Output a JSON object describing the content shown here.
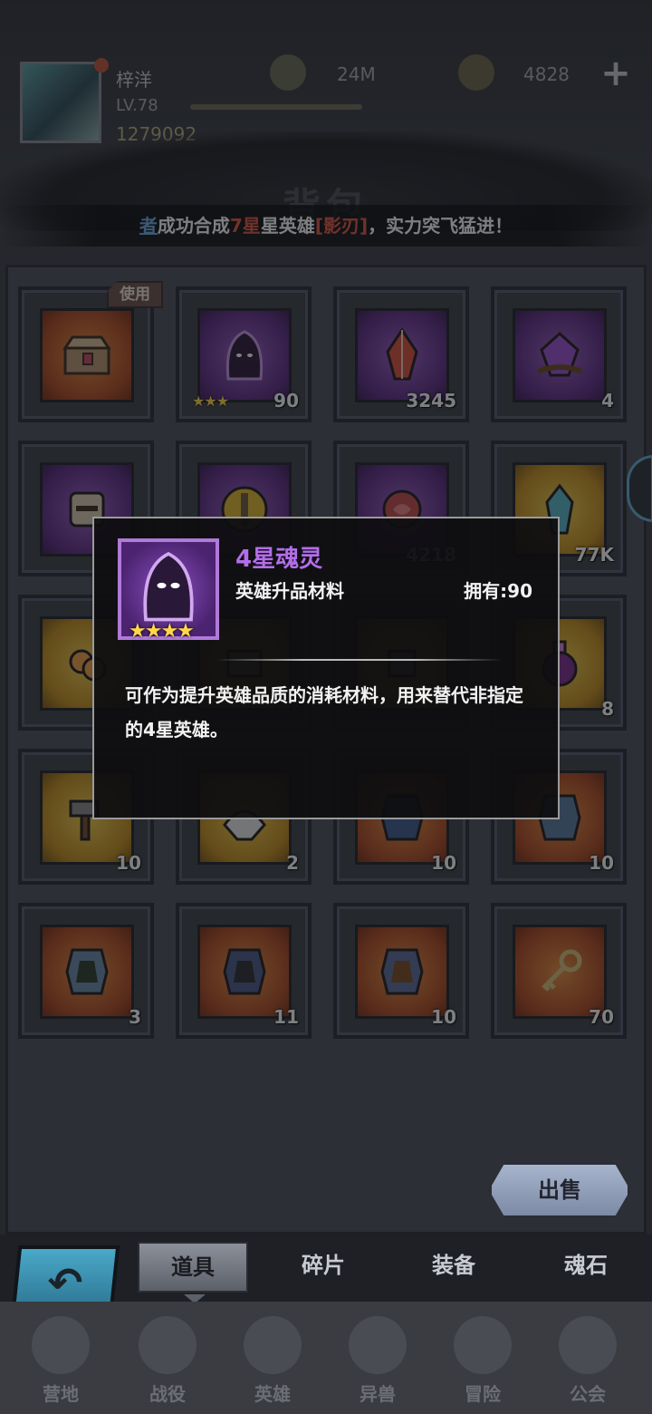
{
  "header": {
    "player_name": "梓洋",
    "level": "LV.78",
    "power": "1279092",
    "resource_1": "24M",
    "resource_2": "4828",
    "plus": "+"
  },
  "title": "背包",
  "ticker": {
    "name": "者",
    "text_1": "成功合成",
    "star": "7星",
    "text_2": "星英雄",
    "hero": "[影刃]",
    "text_3": "，实力突飞猛进！"
  },
  "use_tag": "使用",
  "slots": [
    {
      "count": "",
      "stars": ""
    },
    {
      "count": "90",
      "stars": "★★★"
    },
    {
      "count": "3245",
      "stars": ""
    },
    {
      "count": "4",
      "stars": ""
    },
    {
      "count": "",
      "stars": ""
    },
    {
      "count": "",
      "stars": ""
    },
    {
      "count": "4218",
      "stars": ""
    },
    {
      "count": "77K",
      "stars": ""
    },
    {
      "count": "",
      "stars": ""
    },
    {
      "count": "",
      "stars": ""
    },
    {
      "count": "",
      "stars": ""
    },
    {
      "count": "8",
      "stars": ""
    },
    {
      "count": "10",
      "stars": ""
    },
    {
      "count": "2",
      "stars": ""
    },
    {
      "count": "10",
      "stars": ""
    },
    {
      "count": "10",
      "stars": ""
    },
    {
      "count": "3",
      "stars": ""
    },
    {
      "count": "11",
      "stars": ""
    },
    {
      "count": "10",
      "stars": ""
    },
    {
      "count": "70",
      "stars": ""
    }
  ],
  "tooltip": {
    "name": "4星魂灵",
    "type": "英雄升品材料",
    "owned": "拥有:90",
    "stars": "★★★★",
    "description": "可作为提升英雄品质的消耗材料，用来替代非指定的4星英雄。"
  },
  "sell_button": "出售",
  "tabs": [
    "道具",
    "碎片",
    "装备",
    "魂石"
  ],
  "bottom_nav": [
    "营地",
    "战役",
    "英雄",
    "异兽",
    "冒险",
    "公会"
  ],
  "colors": {
    "rarity_purple": "#b26ee8",
    "highlight_red": "#e0563f",
    "name_blue": "#6ea8e0",
    "star_gold": "#ffd84a"
  }
}
